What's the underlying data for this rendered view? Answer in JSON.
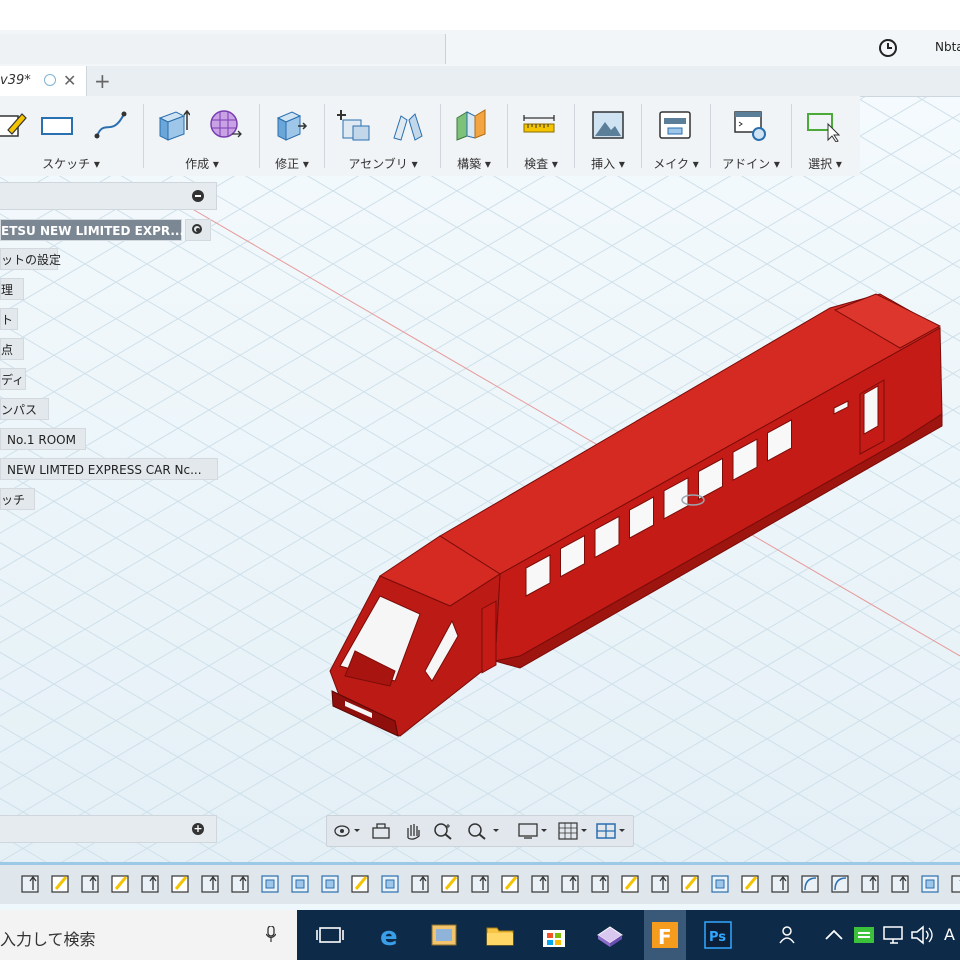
{
  "top": {
    "user_label": "Nbta"
  },
  "tab": {
    "doc_name": "v39*",
    "close": "✕",
    "new_tab": "+"
  },
  "toolbar": {
    "groups": [
      {
        "label": "スケッチ ▾"
      },
      {
        "label": "作成 ▾"
      },
      {
        "label": "修正 ▾"
      },
      {
        "label": "アセンブリ ▾"
      },
      {
        "label": "構築 ▾"
      },
      {
        "label": "検査 ▾"
      },
      {
        "label": "挿入 ▾"
      },
      {
        "label": "メイク ▾"
      },
      {
        "label": "アドイン ▾"
      },
      {
        "label": "選択 ▾"
      }
    ]
  },
  "browser": {
    "nodes": [
      "ETSU NEW LIMITED EXPR...",
      "ットの設定",
      "理",
      "ト",
      "点",
      "ディ",
      "ンパス",
      "No.1 ROOM",
      "NEW LIMTED EXPRESS CAR Nc...",
      "ッチ"
    ]
  },
  "taskbar": {
    "search_text": "入力して検索",
    "clock_text": "A"
  },
  "colors": {
    "model_red": "#c51b16",
    "model_dark": "#8e0f0b",
    "grid_line": "#c9dce6",
    "timeline_accent": "#9cc9e6"
  }
}
